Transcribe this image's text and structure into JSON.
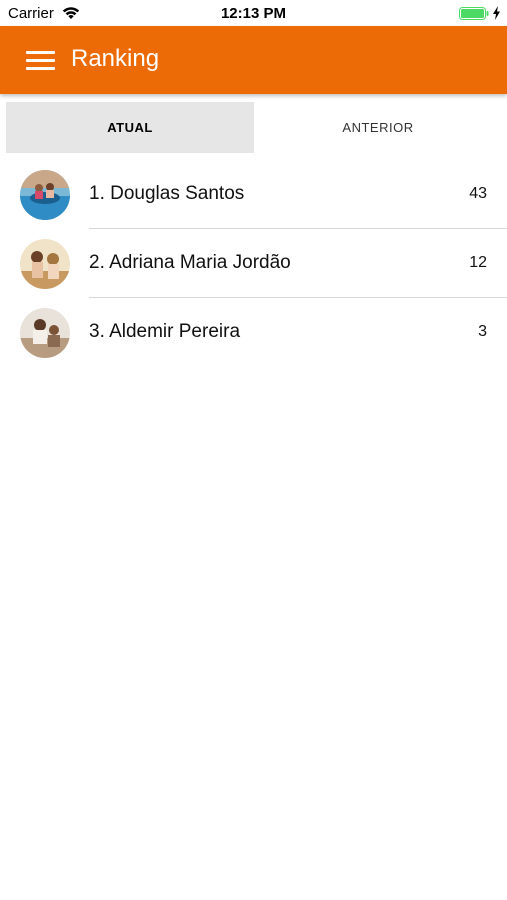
{
  "status_bar": {
    "carrier": "Carrier",
    "time": "12:13 PM",
    "wifi_icon": "wifi-icon",
    "battery_icon": "battery-charging-icon"
  },
  "app_bar": {
    "title": "Ranking",
    "menu_icon": "hamburger-menu-icon",
    "color": "#ec6b06"
  },
  "tabs": [
    {
      "label": "ATUAL",
      "selected": true
    },
    {
      "label": "ANTERIOR",
      "selected": false
    }
  ],
  "ranking": [
    {
      "name": "1. Douglas Santos",
      "score": "43"
    },
    {
      "name": "2. Adriana Maria Jordão",
      "score": "12"
    },
    {
      "name": "3. Aldemir Pereira",
      "score": "3"
    }
  ]
}
